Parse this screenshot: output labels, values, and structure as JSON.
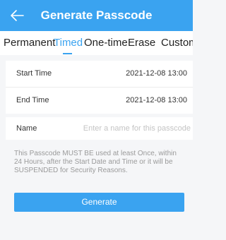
{
  "header": {
    "title": "Generate Passcode"
  },
  "tabs": [
    {
      "label": "Permanent",
      "active": false
    },
    {
      "label": "Timed",
      "active": true
    },
    {
      "label": "One-time",
      "active": false
    },
    {
      "label": "Erase",
      "active": false
    },
    {
      "label": "Custom",
      "active": false
    }
  ],
  "form": {
    "start_label": "Start Time",
    "start_value": "2021-12-08 13:00",
    "end_label": "End Time",
    "end_value": "2021-12-08 13:00",
    "name_label": "Name",
    "name_placeholder": "Enter a name for this passcode",
    "name_value": ""
  },
  "notice": "This Passcode MUST BE used at least Once, within 24 Hours, after the Start Date and Time or it will be SUSPENDED for Security Reasons.",
  "generate_label": "Generate",
  "colors": {
    "accent": "#3aa3f0",
    "background": "#f5f6f8"
  },
  "icons": {
    "back": "arrow-left-icon"
  }
}
